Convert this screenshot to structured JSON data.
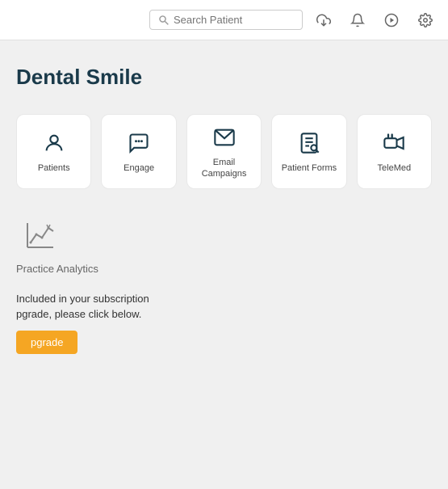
{
  "header": {
    "search_placeholder": "Search Patient",
    "icons": [
      {
        "name": "download-icon",
        "unicode": "⬇",
        "label": "Download"
      },
      {
        "name": "bell-icon",
        "unicode": "🔔",
        "label": "Notifications"
      },
      {
        "name": "play-icon",
        "unicode": "▶",
        "label": "Play"
      },
      {
        "name": "gear-icon",
        "unicode": "⚙",
        "label": "Settings"
      }
    ]
  },
  "app": {
    "title": "Dental Smile"
  },
  "cards": [
    {
      "id": "patients",
      "label": "Patients",
      "icon": "person"
    },
    {
      "id": "engage",
      "label": "Engage",
      "icon": "chat"
    },
    {
      "id": "email-campaigns",
      "label": "Email Campaigns",
      "icon": "email"
    },
    {
      "id": "patient-forms",
      "label": "Patient Forms",
      "icon": "form"
    },
    {
      "id": "telemed",
      "label": "TeleMed",
      "icon": "video"
    }
  ],
  "analytics": {
    "label": "Practice Analytics",
    "icon": "chart"
  },
  "upgrade": {
    "text_line1": "Included in your subscription",
    "text_line2": "pgrade, please click below.",
    "button_label": "pgrade"
  }
}
